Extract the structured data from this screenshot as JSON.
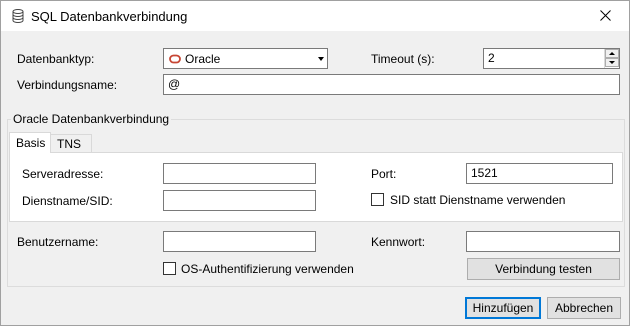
{
  "window": {
    "title": "SQL Datenbankverbindung",
    "close_icon": "close-icon"
  },
  "form": {
    "db_type_label": "Datenbanktyp:",
    "db_type_value": "Oracle",
    "timeout_label": "Timeout (s):",
    "timeout_value": "2",
    "connection_name_label": "Verbindungsname:",
    "connection_name_value": "@"
  },
  "group": {
    "title": "Oracle Datenbankverbindung",
    "tabs": [
      {
        "label": "Basis",
        "active": true
      },
      {
        "label": "TNS",
        "active": false
      }
    ],
    "server_label": "Serveradresse:",
    "server_value": "",
    "port_label": "Port:",
    "port_value": "1521",
    "service_label": "Dienstname/SID:",
    "service_value": "",
    "sid_checkbox_label": "SID statt Dienstname verwenden",
    "sid_checked": false
  },
  "auth": {
    "username_label": "Benutzername:",
    "username_value": "",
    "password_label": "Kennwort:",
    "password_value": "",
    "os_auth_label": "OS-Authentifizierung verwenden",
    "os_auth_checked": false,
    "test_button": "Verbindung testen"
  },
  "footer": {
    "add_button": "Hinzufügen",
    "cancel_button": "Abbrechen"
  },
  "colors": {
    "oracle_red": "#c74634",
    "accent": "#0078d7"
  }
}
